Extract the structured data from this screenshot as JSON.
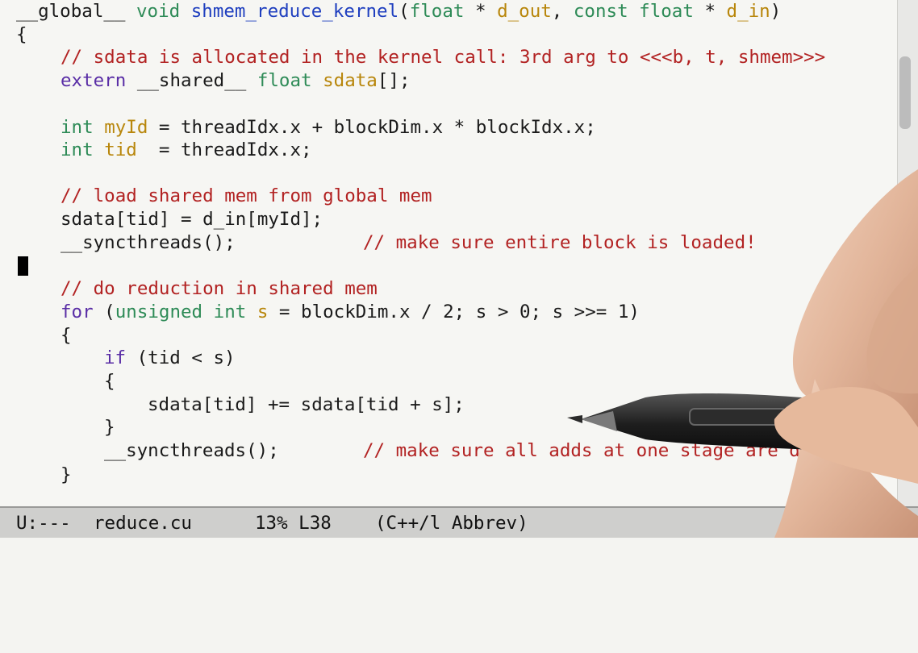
{
  "code": {
    "line1": [
      "__global__",
      " ",
      "void",
      " ",
      "shmem_reduce_kernel",
      "(",
      "float",
      " * ",
      "d_out",
      ", ",
      "const float",
      " * ",
      "d_in",
      ")"
    ],
    "line2": "{",
    "line3": "// sdata is allocated in the kernel call: 3rd arg to <<<b, t, shmem>>>",
    "line4": [
      "extern",
      " ",
      "__shared__",
      " ",
      "float",
      " ",
      "sdata",
      "[];"
    ],
    "line6": [
      "int",
      " ",
      "myId",
      " = threadIdx.x + blockDim.x * blockIdx.x;"
    ],
    "line7": [
      "int",
      " ",
      "tid",
      "  = threadIdx.x;"
    ],
    "line9": "// load shared mem from global mem",
    "line10": "sdata[tid] = d_in[myId];",
    "line11_code": "__syncthreads();",
    "line11_comment": "// make sure entire block is loaded!",
    "line13": "// do reduction in shared mem",
    "line14": [
      "for",
      " (",
      "unsigned int",
      " ",
      "s",
      " = blockDim.x / 2; s > 0; s >>= 1)"
    ],
    "line15": "{",
    "line16": [
      "if",
      " (tid < s)"
    ],
    "line17": "{",
    "line18": "sdata[tid] += sdata[tid + s];",
    "line19": "}",
    "line20_code": "__syncthreads();",
    "line20_comment": "// make sure all adds at one stage are done!",
    "line21": "}"
  },
  "modeline": {
    "status": "U:---",
    "filename": "reduce.cu",
    "position": "13% L38",
    "mode": "(C++/l Abbrev)"
  },
  "colors": {
    "keyword": "#5a2ea6",
    "type": "#2e8b57",
    "function": "#1f3fbf",
    "variable": "#b8860b",
    "comment": "#b22222"
  }
}
